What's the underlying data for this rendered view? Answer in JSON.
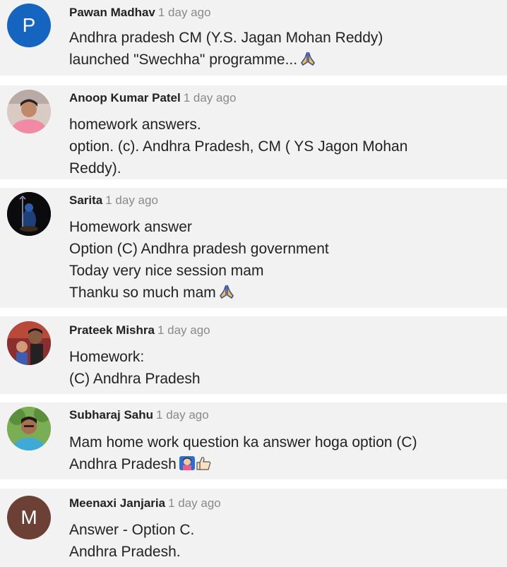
{
  "comments": [
    {
      "author": "Pawan Madhav",
      "time": "1 day ago",
      "avatar_letter": "P",
      "avatar_color": "#1565c0",
      "lines": [
        "Andhra pradesh CM (Y.S. Jagan Mohan Reddy)",
        "launched \"Swechha\" programme..."
      ],
      "emoji": "folded-hands-icon"
    },
    {
      "author": "Anoop Kumar Patel",
      "time": "1 day ago",
      "avatar": "photo",
      "lines": [
        "homework answers.",
        "option. (c). Andhra Pradesh, CM ( YS Jagon Mohan",
        "Reddy)."
      ]
    },
    {
      "author": "Sarita",
      "time": "1 day ago",
      "avatar": "photo",
      "lines": [
        "Homework answer",
        "Option (C) Andhra pradesh government",
        "Today very nice session mam",
        "Thanku so much mam"
      ],
      "emoji": "folded-hands-icon"
    },
    {
      "author": "Prateek Mishra",
      "time": "1 day ago",
      "avatar": "photo",
      "lines": [
        "Homework:",
        "(C) Andhra Pradesh"
      ]
    },
    {
      "author": "Subharaj Sahu",
      "time": "1 day ago",
      "avatar": "photo",
      "lines": [
        "Mam home work question ka answer hoga option (C)",
        "Andhra Pradesh"
      ],
      "emoji": "raising-hand-thumbs-up-icon"
    },
    {
      "author": "Meenaxi Janjaria",
      "time": "1 day ago",
      "avatar_letter": "M",
      "avatar_color": "#6d4035",
      "lines": [
        "Answer - Option C.",
        "Andhra Pradesh."
      ]
    }
  ]
}
